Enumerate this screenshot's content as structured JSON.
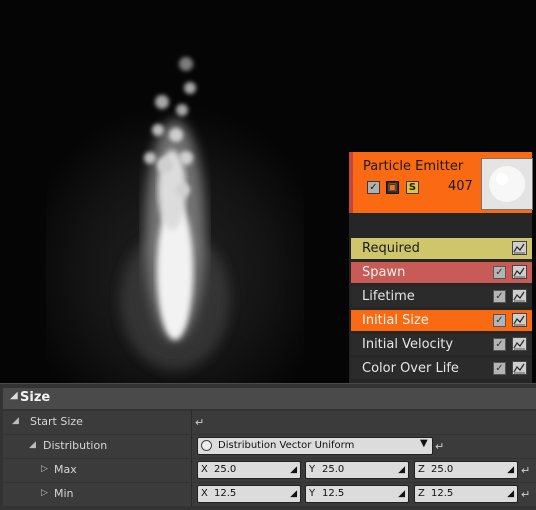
{
  "emitter": {
    "title": "Particle Emitter",
    "particle_count": "407",
    "solo_label": "S",
    "modules": [
      {
        "label": "Required",
        "bg": "#cfc66b",
        "text_color": "#1a1a1a",
        "has_checkbox": false
      },
      {
        "label": "Spawn",
        "bg": "#c85b55",
        "text_color": "#f0f0f0",
        "has_checkbox": true
      },
      {
        "label": "Lifetime",
        "bg": "#2b2b2b",
        "text_color": "#e6e6e6",
        "has_checkbox": true
      },
      {
        "label": "Initial Size",
        "bg": "#fa6a12",
        "text_color": "#f5f5f5",
        "has_checkbox": true
      },
      {
        "label": "Initial Velocity",
        "bg": "#2b2b2b",
        "text_color": "#e6e6e6",
        "has_checkbox": true
      },
      {
        "label": "Color Over Life",
        "bg": "#2b2b2b",
        "text_color": "#e6e6e6",
        "has_checkbox": true
      }
    ]
  },
  "details": {
    "section_title": "Size",
    "start_size_label": "Start Size",
    "distribution_label": "Distribution",
    "distribution_value": "Distribution Vector Uniform",
    "max_label": "Max",
    "min_label": "Min",
    "max": {
      "x": "25.0",
      "y": "25.0",
      "z": "25.0"
    },
    "min": {
      "x": "12.5",
      "y": "12.5",
      "z": "12.5"
    },
    "axis_labels": {
      "x": "X",
      "y": "Y",
      "z": "Z"
    }
  },
  "icons": {
    "reset": "reset-arrow-icon",
    "expand": "triangle-expand-icon",
    "collapse": "triangle-collapse-icon",
    "curve": "curve-editor-icon",
    "checkbox": "checkbox-icon"
  }
}
